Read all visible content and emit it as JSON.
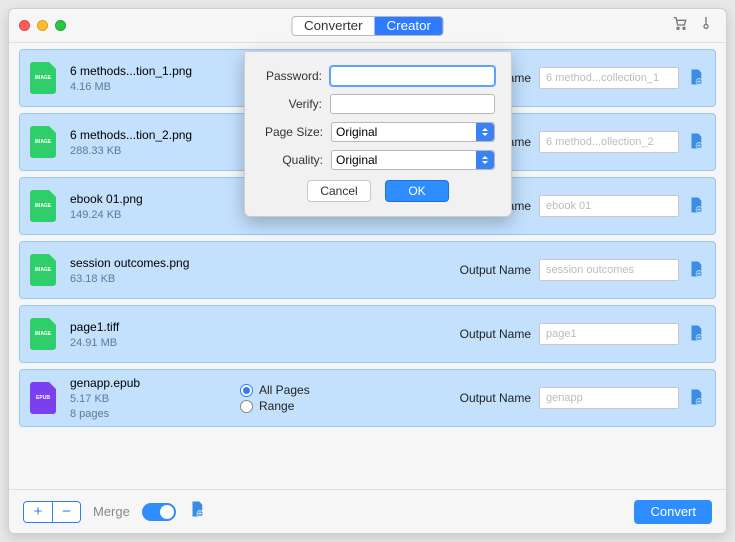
{
  "header": {
    "tabs": {
      "converter": "Converter",
      "creator": "Creator",
      "active": "creator"
    }
  },
  "output_label": "Output Name",
  "pages_choice": {
    "all": "All Pages",
    "range": "Range"
  },
  "rows": [
    {
      "type": "IMAGE",
      "name": "6 methods...tion_1.png",
      "size": "4.16 MB",
      "output": "6 method...collection_1"
    },
    {
      "type": "IMAGE",
      "name": "6 methods...tion_2.png",
      "size": "288.33 KB",
      "output": "6 method...ollection_2"
    },
    {
      "type": "IMAGE",
      "name": "ebook 01.png",
      "size": "149.24 KB",
      "output": "ebook 01"
    },
    {
      "type": "IMAGE",
      "name": "session outcomes.png",
      "size": "63.18 KB",
      "output": "session outcomes"
    },
    {
      "type": "IMAGE",
      "name": "page1.tiff",
      "size": "24.91 MB",
      "output": "page1"
    },
    {
      "type": "EPUB",
      "name": "genapp.epub",
      "size": "5.17 KB",
      "pages": "8 pages",
      "output": "genapp"
    }
  ],
  "footer": {
    "merge": "Merge",
    "convert": "Convert"
  },
  "sheet": {
    "password_label": "Password:",
    "verify_label": "Verify:",
    "pagesize_label": "Page Size:",
    "quality_label": "Quality:",
    "pagesize_value": "Original",
    "quality_value": "Original",
    "cancel": "Cancel",
    "ok": "OK"
  }
}
